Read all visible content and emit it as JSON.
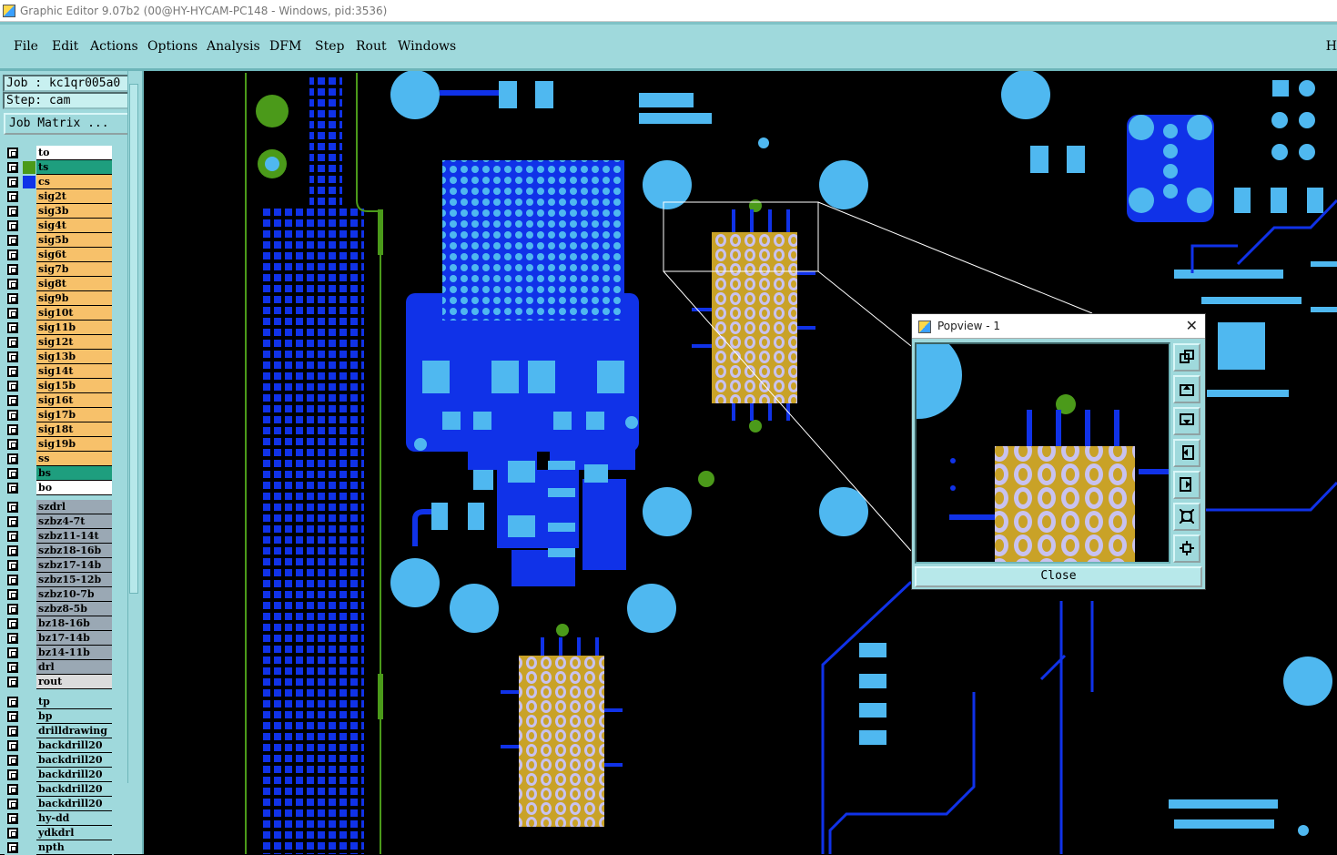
{
  "window": {
    "title": "Graphic Editor 9.07b2 (00@HY-HYCAM-PC148 - Windows, pid:3536)"
  },
  "menubar": {
    "items": [
      "File",
      "Edit",
      "Actions",
      "Options",
      "Analysis",
      "DFM",
      "Step",
      "Rout",
      "Windows"
    ],
    "right_text": "H"
  },
  "left_panel": {
    "job_label": "Job : kc1qr005a0",
    "step_label": "Step: cam",
    "job_matrix_label": "Job Matrix ...",
    "board_layers": [
      {
        "name": "to",
        "bg": "#ffffff",
        "swatch": ""
      },
      {
        "name": "ts",
        "bg": "#1e9e7e",
        "swatch": "#4b9a1a"
      },
      {
        "name": "cs",
        "bg": "#f7c16a",
        "swatch": "#1032e8"
      },
      {
        "name": "sig2t",
        "bg": "#f7c16a",
        "swatch": ""
      },
      {
        "name": "sig3b",
        "bg": "#f7c16a",
        "swatch": ""
      },
      {
        "name": "sig4t",
        "bg": "#f7c16a",
        "swatch": ""
      },
      {
        "name": "sig5b",
        "bg": "#f7c16a",
        "swatch": ""
      },
      {
        "name": "sig6t",
        "bg": "#f7c16a",
        "swatch": ""
      },
      {
        "name": "sig7b",
        "bg": "#f7c16a",
        "swatch": ""
      },
      {
        "name": "sig8t",
        "bg": "#f7c16a",
        "swatch": ""
      },
      {
        "name": "sig9b",
        "bg": "#f7c16a",
        "swatch": ""
      },
      {
        "name": "sig10t",
        "bg": "#f7c16a",
        "swatch": ""
      },
      {
        "name": "sig11b",
        "bg": "#f7c16a",
        "swatch": ""
      },
      {
        "name": "sig12t",
        "bg": "#f7c16a",
        "swatch": ""
      },
      {
        "name": "sig13b",
        "bg": "#f7c16a",
        "swatch": ""
      },
      {
        "name": "sig14t",
        "bg": "#f7c16a",
        "swatch": ""
      },
      {
        "name": "sig15b",
        "bg": "#f7c16a",
        "swatch": ""
      },
      {
        "name": "sig16t",
        "bg": "#f7c16a",
        "swatch": ""
      },
      {
        "name": "sig17b",
        "bg": "#f7c16a",
        "swatch": ""
      },
      {
        "name": "sig18t",
        "bg": "#f7c16a",
        "swatch": ""
      },
      {
        "name": "sig19b",
        "bg": "#f7c16a",
        "swatch": ""
      },
      {
        "name": "ss",
        "bg": "#f7c16a",
        "swatch": ""
      },
      {
        "name": "bs",
        "bg": "#1e9e7e",
        "swatch": ""
      },
      {
        "name": "bo",
        "bg": "#ffffff",
        "swatch": ""
      }
    ],
    "drill_layers": [
      {
        "name": "szdrl",
        "bg": "#9aa8b4"
      },
      {
        "name": "szbz4-7t",
        "bg": "#9aa8b4"
      },
      {
        "name": "szbz11-14t",
        "bg": "#9aa8b4"
      },
      {
        "name": "szbz18-16b",
        "bg": "#9aa8b4"
      },
      {
        "name": "szbz17-14b",
        "bg": "#9aa8b4"
      },
      {
        "name": "szbz15-12b",
        "bg": "#9aa8b4"
      },
      {
        "name": "szbz10-7b",
        "bg": "#9aa8b4"
      },
      {
        "name": "szbz8-5b",
        "bg": "#9aa8b4"
      },
      {
        "name": "bz18-16b",
        "bg": "#9aa8b4"
      },
      {
        "name": "bz17-14b",
        "bg": "#9aa8b4"
      },
      {
        "name": "bz14-11b",
        "bg": "#9aa8b4"
      },
      {
        "name": "drl",
        "bg": "#9aa8b4"
      },
      {
        "name": "rout",
        "bg": "#dcdcdc"
      }
    ],
    "misc_layers": [
      {
        "name": "tp",
        "bg": "#9fd9dc"
      },
      {
        "name": "bp",
        "bg": "#9fd9dc"
      },
      {
        "name": "drilldrawing",
        "bg": "#9fd9dc"
      },
      {
        "name": "backdrill20",
        "bg": "#9fd9dc"
      },
      {
        "name": "backdrill20",
        "bg": "#9fd9dc"
      },
      {
        "name": "backdrill20",
        "bg": "#9fd9dc"
      },
      {
        "name": "backdrill20",
        "bg": "#9fd9dc"
      },
      {
        "name": "backdrill20",
        "bg": "#9fd9dc"
      },
      {
        "name": "hy-dd",
        "bg": "#9fd9dc"
      },
      {
        "name": "ydkdrl",
        "bg": "#9fd9dc"
      },
      {
        "name": "npth",
        "bg": "#9fd9dc"
      }
    ]
  },
  "popview": {
    "title": "Popview - 1",
    "close_button": "Close",
    "tools": [
      "zoom-home-icon",
      "pan-up-icon",
      "pan-down-icon",
      "pan-left-icon",
      "pan-right-icon",
      "zoom-in-icon",
      "zoom-out-icon"
    ]
  },
  "colors": {
    "accent": "#9fd9dc",
    "copper": "#1032e8",
    "pad": "#4fb8f0",
    "mask": "#4b9a1a",
    "bga_gold": "#c9a227",
    "bga_lavender": "#c8c2f0"
  }
}
